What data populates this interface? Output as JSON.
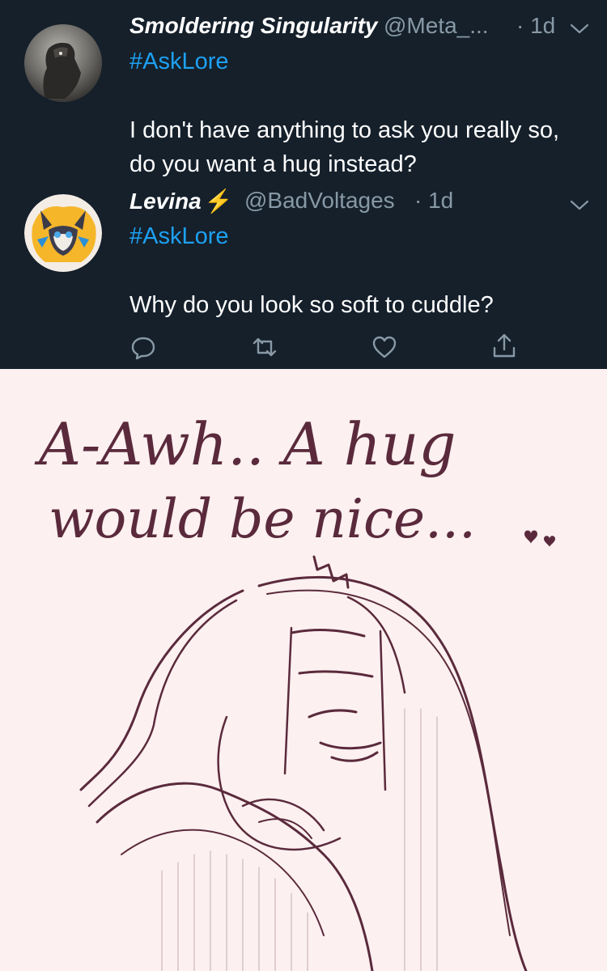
{
  "tweets": [
    {
      "name": "Smoldering Singularity",
      "handle": "@Meta_...",
      "time": "· 1d",
      "hashtag": "#AskLore",
      "text": "I don't have anything to ask you really so, do you want a hug instead?",
      "avatar_icon": "dark-creature-avatar"
    },
    {
      "name": "Levina",
      "name_badge": "⚡",
      "handle": "@BadVoltages",
      "time": "· 1d",
      "hashtag": "#AskLore",
      "text": "Why do you look so soft to cuddle?",
      "avatar_icon": "yellow-creature-avatar"
    }
  ],
  "actions": [
    "reply-icon",
    "retweet-icon",
    "like-icon",
    "share-icon"
  ],
  "colors": {
    "background": "#15202b",
    "text": "#ffffff",
    "muted": "#8899a6",
    "link": "#1da1f2",
    "sketch_bg": "#fcf0f0",
    "sketch_ink": "#5a2a3c"
  },
  "sketch": {
    "caption_line1": "A-Awh.. A hug",
    "caption_line2": "would be nice..."
  }
}
